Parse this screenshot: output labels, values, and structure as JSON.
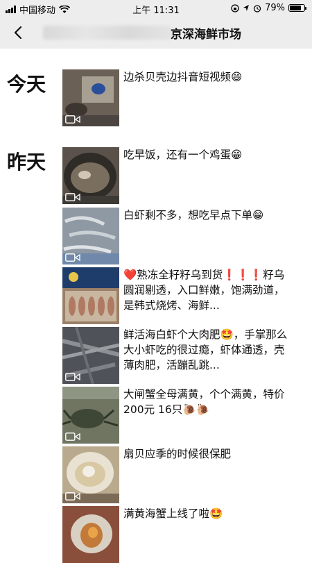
{
  "status_bar": {
    "carrier": "中国移动",
    "time": "上午 11:31",
    "battery": "79%",
    "battery_level": 0.79
  },
  "nav": {
    "title_visible": "京深海鲜市场"
  },
  "feed": {
    "days": [
      {
        "label": "今天"
      },
      {
        "label": "昨天"
      }
    ],
    "posts": [
      {
        "text": "边杀贝壳边抖音短视频😄",
        "thumb_color": "#6a6055"
      },
      {
        "text": "吃早饭，还有一个鸡蛋😁",
        "thumb_color": "#5a524a"
      },
      {
        "text": "白虾剩不多，想吃早点下单😁",
        "thumb_color": "#8f99a3"
      },
      {
        "text": "❤️熟冻全籽籽乌到货❗❗❗籽乌圆润剔透，入口鲜嫩，饱满劲道，是韩式烧烤、海鲜...",
        "thumb_color": "#9a8068"
      },
      {
        "text": "鲜活海白虾个大肉肥🤩，手掌那么大小虾吃的很过瘾，虾体通透，壳薄肉肥，活蹦乱跳...",
        "thumb_color": "#4f5258"
      },
      {
        "text": "大闸蟹全母满黄，个个满黄，特价 200元 16只🐌🐌",
        "thumb_color": "#6f7560"
      },
      {
        "text": "扇贝应季的时候很保肥",
        "thumb_color": "#b9aa8e"
      },
      {
        "text": "满黄海蟹上线了啦🤩",
        "thumb_color": "#8a4f3a"
      }
    ]
  }
}
